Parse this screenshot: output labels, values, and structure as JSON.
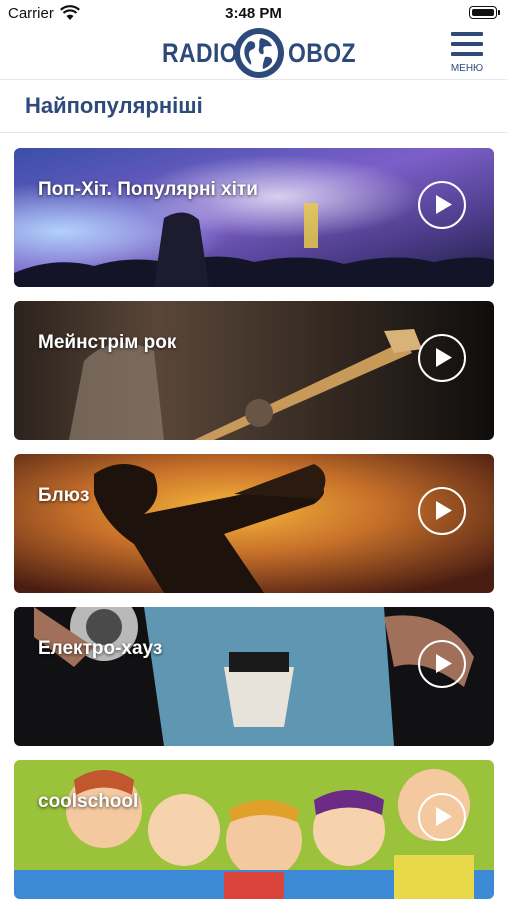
{
  "status_bar": {
    "carrier": "Carrier",
    "time": "3:48 PM",
    "icons": [
      "wifi-icon",
      "battery-icon"
    ]
  },
  "header": {
    "logo_left": "RADIO",
    "logo_right": "OBOZ",
    "logo_icon": "globe-icon",
    "menu_label": "МЕНЮ",
    "menu_icon": "hamburger-icon"
  },
  "section": {
    "title": "Найпопулярніші"
  },
  "stations": [
    {
      "title": "Поп-Хіт. Популярні хіти",
      "icon": "play-icon"
    },
    {
      "title": "Мейнстрім рок",
      "icon": "play-icon"
    },
    {
      "title": "Блюз",
      "icon": "play-icon"
    },
    {
      "title": "Електро-хауз",
      "icon": "play-icon"
    },
    {
      "title": "coolschool",
      "icon": "play-icon"
    }
  ],
  "colors": {
    "brand": "#2d4a7a",
    "text_on_image": "#ffffff"
  }
}
